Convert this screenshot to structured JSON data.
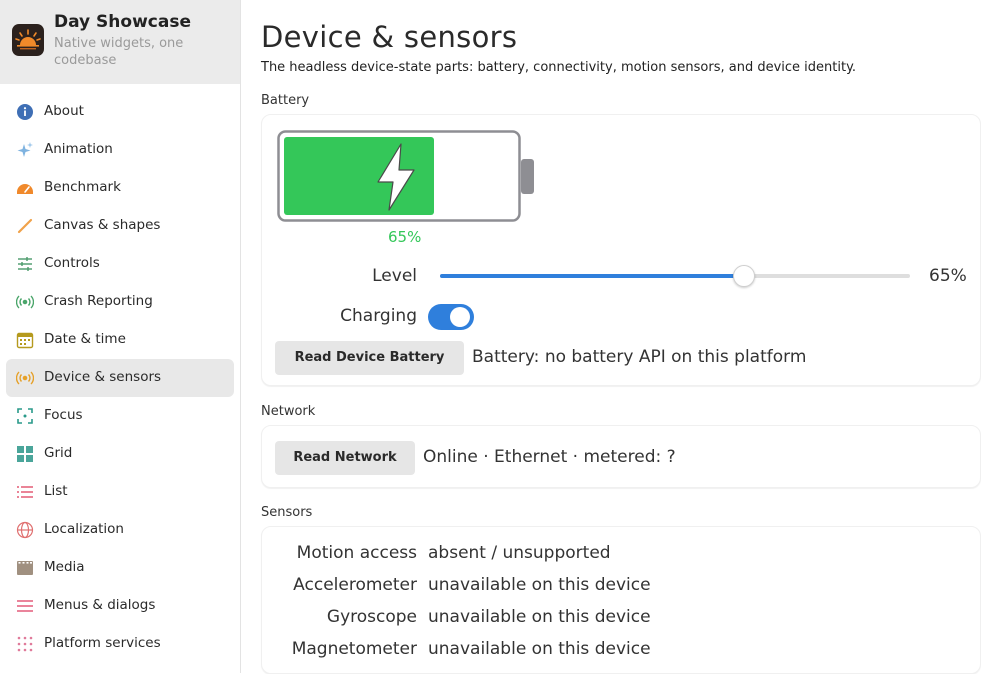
{
  "app": {
    "title": "Day Showcase",
    "subtitle": "Native widgets, one codebase",
    "logo_icon": "sunrise-logo"
  },
  "sidebar": {
    "items": [
      {
        "label": "About",
        "icon": "info-icon",
        "color": "#3f6fb5",
        "active": false
      },
      {
        "label": "Animation",
        "icon": "sparkle-icon",
        "color": "#7fb3e0",
        "active": false
      },
      {
        "label": "Benchmark",
        "icon": "gauge-icon",
        "color": "#f0892b",
        "active": false
      },
      {
        "label": "Canvas & shapes",
        "icon": "brush-icon",
        "color": "#f0a24a",
        "active": false
      },
      {
        "label": "Controls",
        "icon": "sliders-icon",
        "color": "#4a9a6a",
        "active": false
      },
      {
        "label": "Crash Reporting",
        "icon": "broadcast-icon",
        "color": "#4aa56a",
        "active": false
      },
      {
        "label": "Date & time",
        "icon": "calendar-icon",
        "color": "#b59a1e",
        "active": false
      },
      {
        "label": "Device & sensors",
        "icon": "sensor-icon",
        "color": "#e6a12a",
        "active": true
      },
      {
        "label": "Focus",
        "icon": "focus-icon",
        "color": "#2a9a8a",
        "active": false
      },
      {
        "label": "Grid",
        "icon": "grid-icon",
        "color": "#4aa59a",
        "active": false
      },
      {
        "label": "List",
        "icon": "list-icon",
        "color": "#e0506a",
        "active": false
      },
      {
        "label": "Localization",
        "icon": "globe-icon",
        "color": "#e07070",
        "active": false
      },
      {
        "label": "Media",
        "icon": "film-icon",
        "color": "#a09080",
        "active": false
      },
      {
        "label": "Menus & dialogs",
        "icon": "menu-icon",
        "color": "#e05070",
        "active": false
      },
      {
        "label": "Platform services",
        "icon": "dots-grid-icon",
        "color": "#e07a9a",
        "active": false
      }
    ]
  },
  "main": {
    "title": "Device & sensors",
    "description": "The headless device-state parts: battery, connectivity, motion sensors, and device identity.",
    "battery": {
      "section_label": "Battery",
      "level_percent": 65,
      "level_text": "65%",
      "charging": true,
      "level_label": "Level",
      "slider_value_text": "65%",
      "charging_label": "Charging",
      "read_button": "Read Device Battery",
      "status": "Battery: no battery API on this platform",
      "fill_color": "#34c759"
    },
    "network": {
      "section_label": "Network",
      "read_button": "Read Network",
      "status": "Online · Ethernet · metered: ?"
    },
    "sensors": {
      "section_label": "Sensors",
      "rows": [
        {
          "label": "Motion access",
          "value": "absent / unsupported"
        },
        {
          "label": "Accelerometer",
          "value": "unavailable on this device"
        },
        {
          "label": "Gyroscope",
          "value": "unavailable on this device"
        },
        {
          "label": "Magnetometer",
          "value": "unavailable on this device"
        }
      ]
    }
  }
}
